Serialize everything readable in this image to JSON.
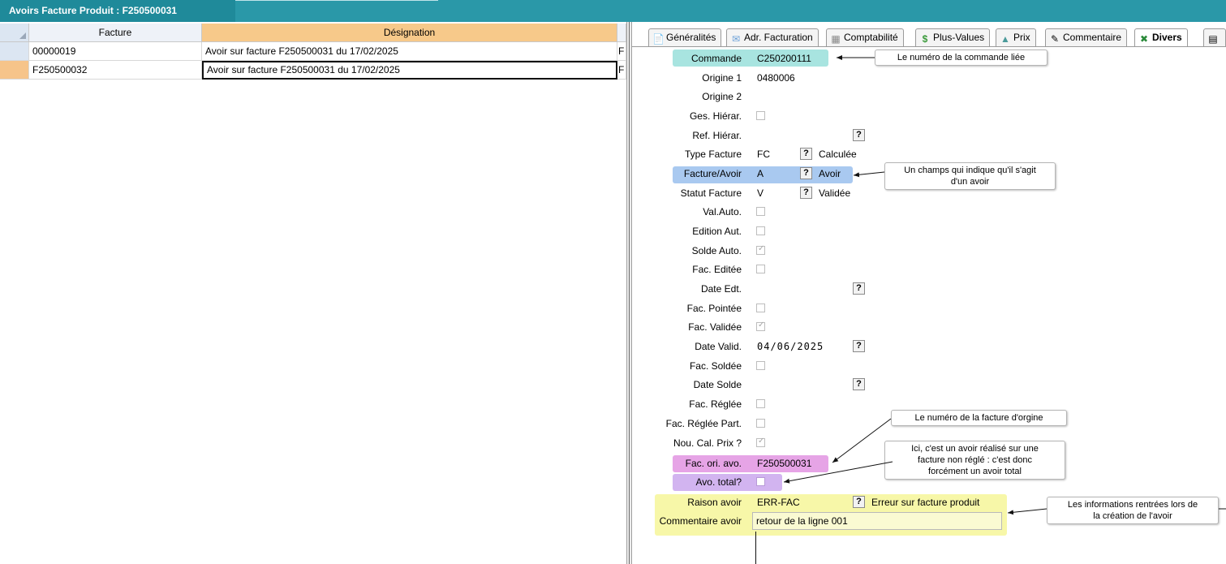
{
  "window": {
    "title": "Avoirs Facture Produit : F250500031"
  },
  "grid": {
    "columns": [
      "Facture",
      "Désignation"
    ],
    "rows": [
      {
        "facture": "00000019",
        "designation": "Avoir sur facture F250500031 du 17/02/2025",
        "more": "F"
      },
      {
        "facture": "F250500032",
        "designation": "Avoir sur facture F250500031 du 17/02/2025",
        "more": "F"
      }
    ]
  },
  "tabs": [
    {
      "label": "Généralités",
      "icon": "document-icon"
    },
    {
      "label": "Adr. Facturation",
      "icon": "envelope-icon"
    },
    {
      "label": "Comptabilité",
      "icon": "calculator-icon"
    },
    {
      "label": "Plus-Values",
      "icon": "dollar-icon"
    },
    {
      "label": "Prix",
      "icon": "price-icon"
    },
    {
      "label": "Commentaire",
      "icon": "pen-icon"
    },
    {
      "label": "Divers",
      "icon": "excel-icon"
    }
  ],
  "form": {
    "commande": {
      "label": "Commande",
      "value": "C250200111"
    },
    "origine1": {
      "label": "Origine 1",
      "value": "0480006"
    },
    "origine2": {
      "label": "Origine 2",
      "value": ""
    },
    "ges_hierar": {
      "label": "Ges. Hiérar."
    },
    "ref_hierar": {
      "label": "Ref. Hiérar."
    },
    "type_facture": {
      "label": "Type Facture",
      "value": "FC",
      "desc": "Calculée"
    },
    "facture_avoir": {
      "label": "Facture/Avoir",
      "value": "A",
      "desc": "Avoir"
    },
    "statut_facture": {
      "label": "Statut Facture",
      "value": "V",
      "desc": "Validée"
    },
    "val_auto": {
      "label": "Val.Auto."
    },
    "edition_aut": {
      "label": "Edition Aut."
    },
    "solde_auto": {
      "label": "Solde Auto."
    },
    "fac_editee": {
      "label": "Fac. Editée"
    },
    "date_edt": {
      "label": "Date Edt."
    },
    "fac_pointee": {
      "label": "Fac. Pointée"
    },
    "fac_validee": {
      "label": "Fac. Validée"
    },
    "date_valid": {
      "label": "Date Valid.",
      "value": "04/06/2025"
    },
    "fac_soldee": {
      "label": "Fac. Soldée"
    },
    "date_solde": {
      "label": "Date Solde"
    },
    "fac_reglee": {
      "label": "Fac. Réglée"
    },
    "fac_reglee_part": {
      "label": "Fac. Réglée Part."
    },
    "nou_cal_prix": {
      "label": "Nou. Cal. Prix ?"
    },
    "fac_ori_avo": {
      "label": "Fac. ori. avo.",
      "value": "F250500031"
    },
    "avo_total": {
      "label": "Avo. total?"
    },
    "raison_avoir": {
      "label": "Raison avoir",
      "value": "ERR-FAC",
      "desc": "Erreur sur facture produit"
    },
    "commentaire_avoir": {
      "label": "Commentaire avoir",
      "value": "retour de la ligne 001"
    },
    "qmark": "?"
  },
  "callouts": {
    "commande": "Le numéro de la commande liée",
    "avoir_line1": "Un champs qui indique qu'il s'agit",
    "avoir_line2": "d'un avoir",
    "origine": "Le numéro de la facture d'orgine",
    "total_line1": "Ici, c'est un avoir réalisé sur une",
    "total_line2": "facture non réglé : c'est donc",
    "total_line3": "forcément un avoir total",
    "infos_line1": "Les informations rentrées lors de",
    "infos_line2": "la création de l'avoir"
  },
  "colors": {
    "titlebar": "#2a98a8",
    "highlight_cyan": "#a8e4e0",
    "highlight_blue": "#a9c9f0",
    "highlight_pink": "#e6a4e6",
    "highlight_purple": "#d2b4f0",
    "highlight_yellow": "#f7f7a8"
  }
}
